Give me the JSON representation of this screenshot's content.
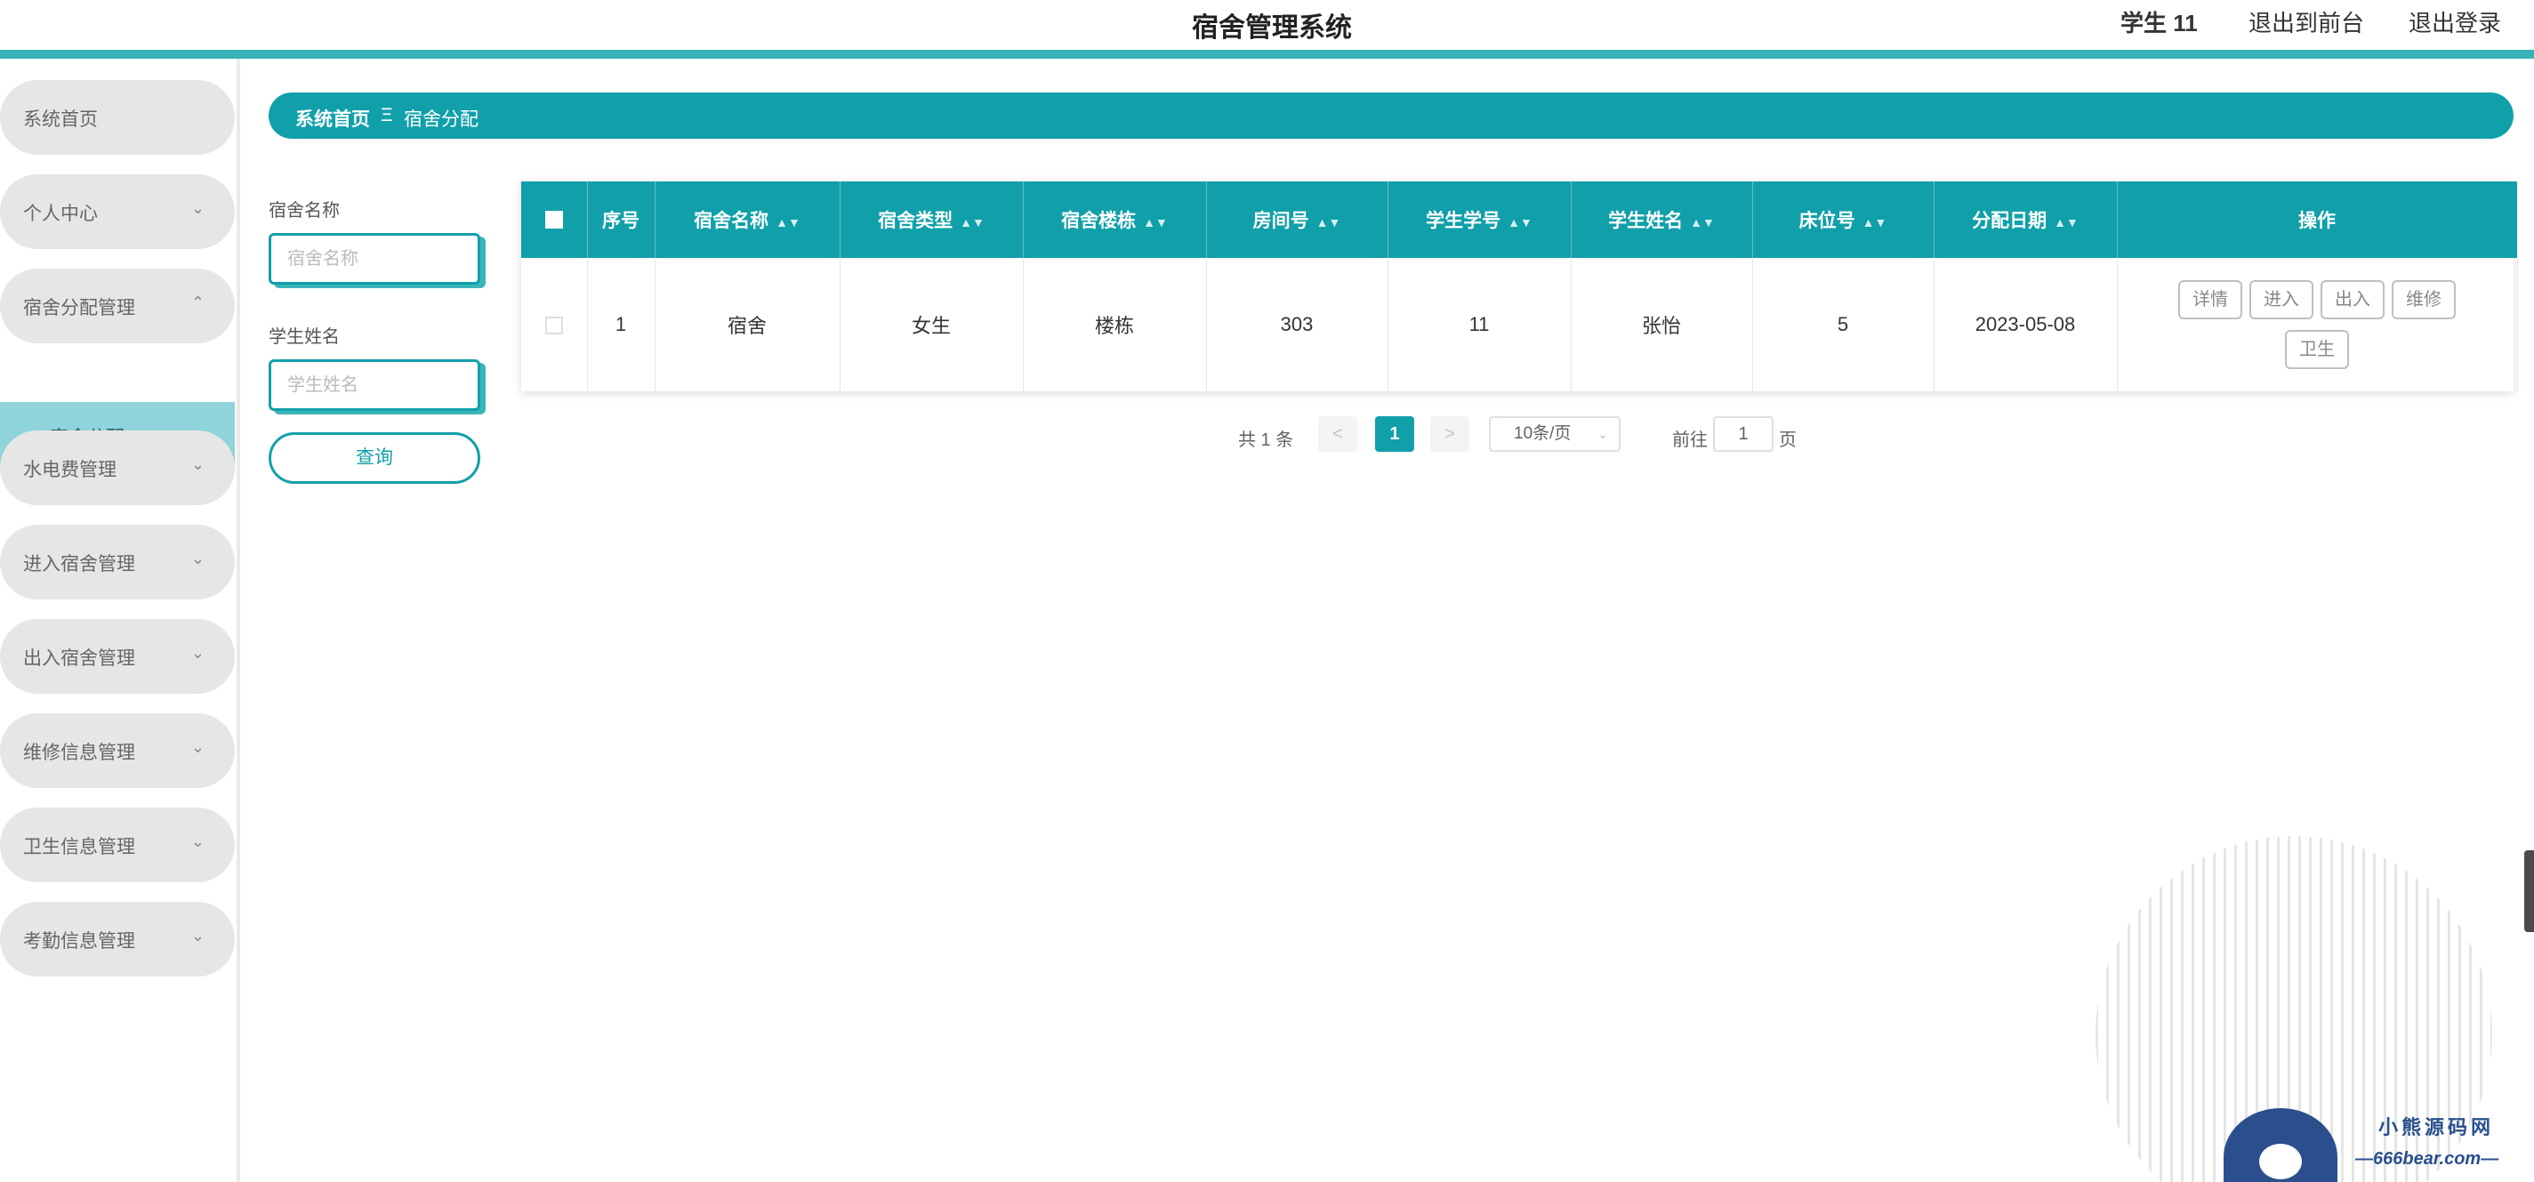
{
  "header": {
    "title": "宿舍管理系统",
    "user": "学生 11",
    "back_to_front": "退出到前台",
    "logout": "退出登录"
  },
  "sidebar": {
    "items": [
      {
        "label": "系统首页",
        "chevron": ""
      },
      {
        "label": "个人中心",
        "chevron": "⌄"
      },
      {
        "label": "宿舍分配管理",
        "chevron": "⌃"
      },
      {
        "label": "水电费管理",
        "chevron": "⌄"
      },
      {
        "label": "进入宿舍管理",
        "chevron": "⌄"
      },
      {
        "label": "出入宿舍管理",
        "chevron": "⌄"
      },
      {
        "label": "维修信息管理",
        "chevron": "⌄"
      },
      {
        "label": "卫生信息管理",
        "chevron": "⌄"
      },
      {
        "label": "考勤信息管理",
        "chevron": "⌄"
      }
    ],
    "active_sub": "宿舍分配"
  },
  "breadcrumb": {
    "home": "系统首页",
    "separator": "Ξ",
    "current": "宿舍分配"
  },
  "search": {
    "dorm_label": "宿舍名称",
    "dorm_placeholder": "宿舍名称",
    "student_label": "学生姓名",
    "student_placeholder": "学生姓名",
    "query_button": "查询"
  },
  "table": {
    "headers": [
      "序号",
      "宿舍名称",
      "宿舍类型",
      "宿舍楼栋",
      "房间号",
      "学生学号",
      "学生姓名",
      "床位号",
      "分配日期",
      "操作"
    ],
    "rows": [
      {
        "index": "1",
        "dorm_name": "宿舍",
        "dorm_type": "女生",
        "building": "楼栋",
        "room": "303",
        "student_id": "11",
        "student_name": "张怡",
        "bed": "5",
        "date": "2023-05-08"
      }
    ],
    "actions": [
      "详情",
      "进入",
      "出入",
      "维修",
      "卫生"
    ]
  },
  "pagination": {
    "total": "共 1 条",
    "prev": "<",
    "current": "1",
    "next": ">",
    "page_size": "10条/页",
    "goto_label": "前往",
    "goto_value": "1",
    "goto_unit": "页"
  },
  "watermark": {
    "cn": "小熊源码网",
    "en": "—666bear.com—"
  },
  "colors": {
    "primary": "#11a0aa",
    "header_line": "#37b3b7",
    "active_sub_bg": "#8fd4da"
  }
}
